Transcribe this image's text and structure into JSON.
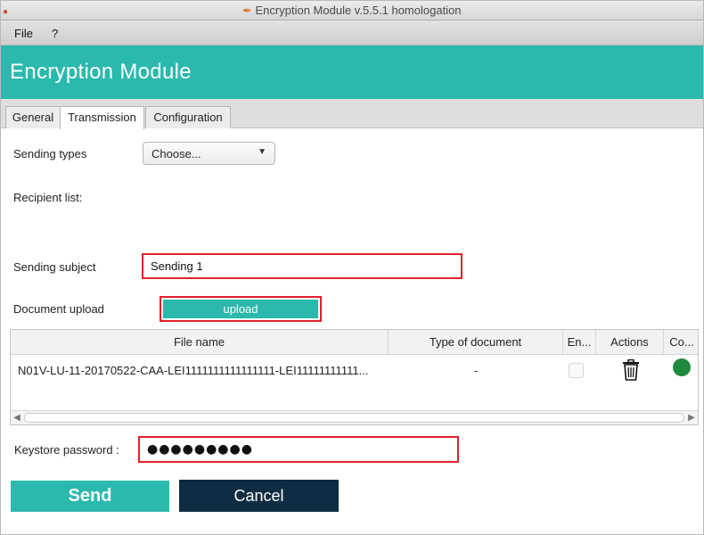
{
  "window": {
    "title": "Encryption Module v.5.5.1 homologation"
  },
  "menu": [
    {
      "label": "File"
    },
    {
      "label": "?"
    }
  ],
  "banner": {
    "title": "Encryption Module"
  },
  "tabs": [
    {
      "label": "General"
    },
    {
      "label": "Transmission"
    },
    {
      "label": "Configuration"
    }
  ],
  "form": {
    "sending_types_label": "Sending types",
    "sending_types_value": "Choose...",
    "recipient_list_label": "Recipient list:",
    "subject_label": "Sending subject",
    "subject_value": "Sending 1",
    "document_upload_label": "Document upload",
    "upload_button": "upload",
    "keystore_label": "Keystore password :",
    "keystore_value": "●●●●●●●●●"
  },
  "table": {
    "columns": [
      {
        "label": "File name"
      },
      {
        "label": "Type of document"
      },
      {
        "label": "En..."
      },
      {
        "label": "Actions"
      },
      {
        "label": "Co..."
      }
    ],
    "rows": [
      {
        "file_name": "N01V-LU-11-20170522-CAA-LEI1111111111111111-LEI11111111111...",
        "type_of_document": "-",
        "encrypted": false,
        "action_icon": "trash-icon",
        "status_color": "#1f8a3d"
      }
    ]
  },
  "actions": {
    "send": "Send",
    "cancel": "Cancel"
  },
  "colors": {
    "accent": "#2bb9ad",
    "cancel_bg": "#0f2d42",
    "highlight": "#e0212a",
    "status_ok": "#1f8a3d"
  }
}
